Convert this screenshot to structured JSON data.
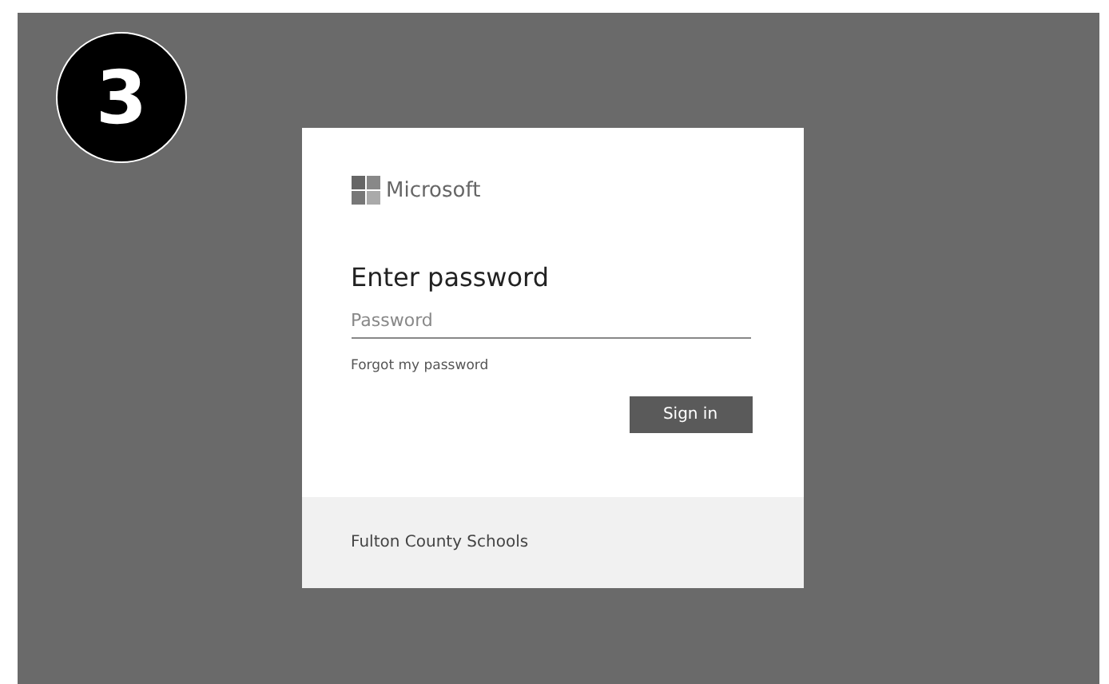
{
  "step_badge": "3",
  "login_card": {
    "logo_text": "Microsoft",
    "title": "Enter password",
    "password_field": {
      "placeholder": "Password"
    },
    "forgot_link": "Forgot my password",
    "sign_in_button": "Sign in",
    "footer": "Fulton County Schools"
  }
}
